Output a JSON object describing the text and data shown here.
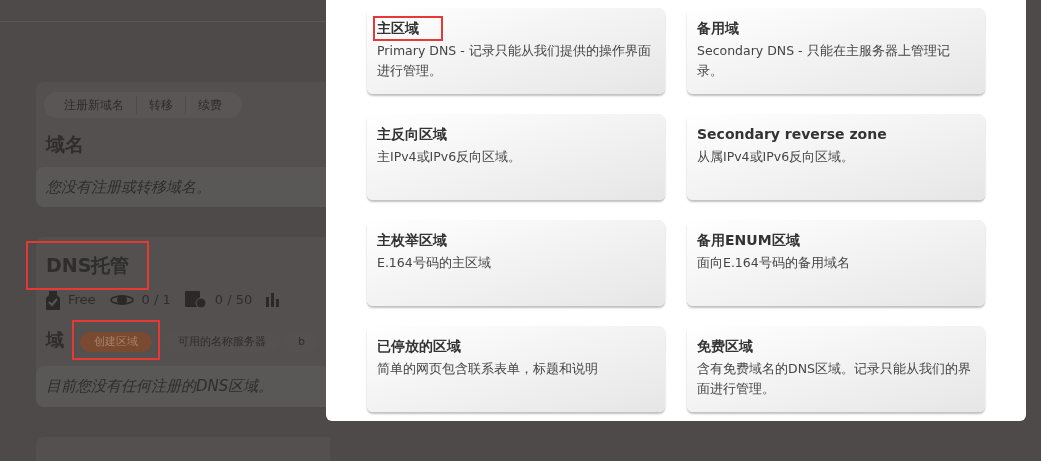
{
  "background_page": {
    "domain_tabs": [
      "注册新域名",
      "转移",
      "续费"
    ],
    "domains": {
      "title": "域名",
      "empty_message": "您没有注册或转移域名。"
    },
    "dns_hosting": {
      "title": "DNS托管",
      "highlighted": true,
      "stats": [
        {
          "kind": "plan",
          "value": "Free"
        },
        {
          "kind": "zones",
          "value": "0 / 1"
        },
        {
          "kind": "records",
          "value": "0 / 50"
        }
      ],
      "zones_heading": "域",
      "actions": [
        {
          "label": "创建区域",
          "kind": "primary",
          "highlighted": true
        },
        {
          "label": "可用的名称服务器",
          "kind": "plain",
          "highlighted": false
        },
        {
          "label": "b",
          "kind": "plain",
          "highlighted": false
        }
      ],
      "empty_message": "目前您没有任何注册的DNS区域。"
    }
  },
  "modal": {
    "zone_types": [
      {
        "title": "主区域",
        "description": "Primary DNS - 记录只能从我们提供的操作界面进行管理。",
        "highlighted": true
      },
      {
        "title": "备用域",
        "description": "Secondary DNS - 只能在主服务器上管理记录。",
        "highlighted": false
      },
      {
        "title": "主反向区域",
        "description": "主IPv4或IPv6反向区域。",
        "highlighted": false
      },
      {
        "title": "Secondary reverse zone",
        "description": "从属IPv4或IPv6反向区域。",
        "highlighted": false
      },
      {
        "title": "主枚举区域",
        "description": "E.164号码的主区域",
        "highlighted": false
      },
      {
        "title": "备用ENUM区域",
        "description": "面向E.164号码的备用域名",
        "highlighted": false
      },
      {
        "title": "已停放的区域",
        "description": "简单的网页包含联系表单，标题和说明",
        "highlighted": false
      },
      {
        "title": "免费区域",
        "description": "含有免费域名的DNS区域。记录只能从我们的界面进行管理。",
        "highlighted": false
      }
    ]
  }
}
